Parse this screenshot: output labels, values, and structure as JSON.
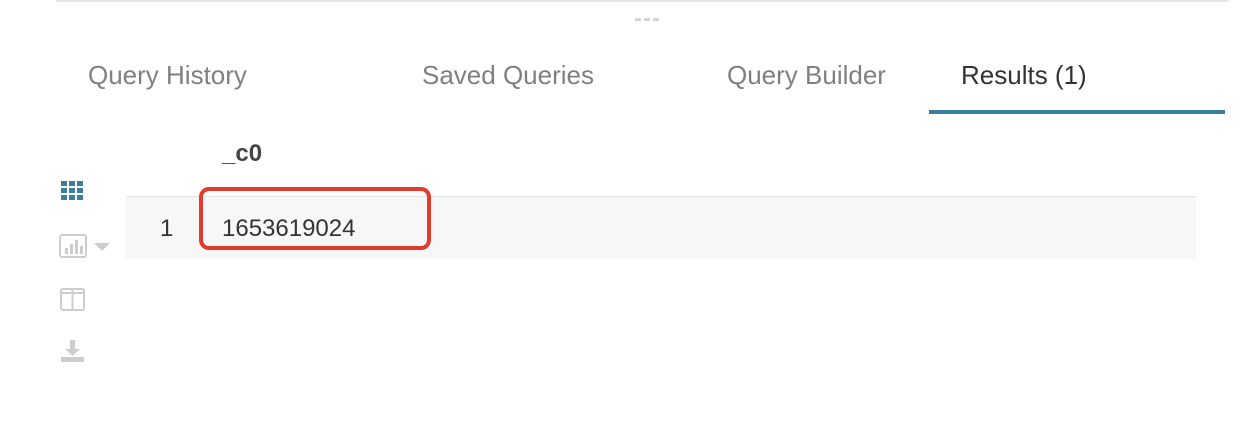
{
  "tabs": [
    {
      "label": "Query History",
      "active": false
    },
    {
      "label": "Saved Queries",
      "active": false
    },
    {
      "label": "Query Builder",
      "active": false
    },
    {
      "label": "Results (1)",
      "active": true
    }
  ],
  "sidebar": {
    "tools": [
      {
        "icon": "grid-icon",
        "active": true
      },
      {
        "icon": "bar-chart-icon",
        "has_dropdown": true,
        "active": false
      },
      {
        "icon": "columns-icon",
        "active": false
      },
      {
        "icon": "download-icon",
        "active": false
      }
    ]
  },
  "results": {
    "columns": [
      "_c0"
    ],
    "rows": [
      {
        "num": "1",
        "values": [
          "1653619024"
        ]
      }
    ]
  },
  "colors": {
    "accent": "#3a7ea1",
    "active_icon": "#3a7ea1",
    "inactive_icon": "#cdcdcd",
    "row_background": "#f7f7f7",
    "highlight": "#e23a2c"
  }
}
